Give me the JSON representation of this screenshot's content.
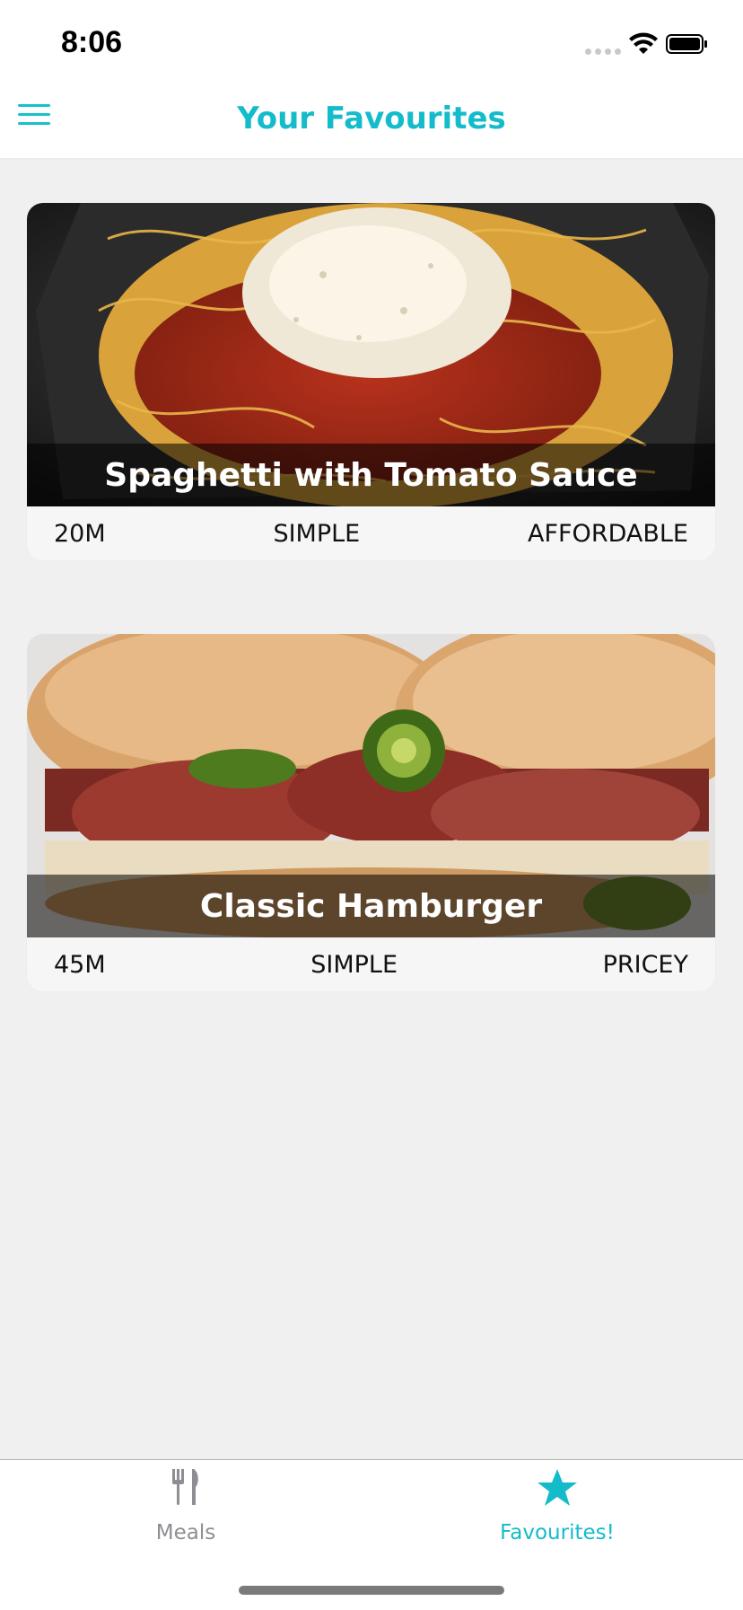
{
  "status_bar": {
    "time": "8:06"
  },
  "header": {
    "title": "Your Favourites",
    "menu_icon": "hamburger-menu-icon"
  },
  "favourites": [
    {
      "title": "Spaghetti with Tomato Sauce",
      "duration": "20M",
      "complexity": "SIMPLE",
      "affordability": "AFFORDABLE"
    },
    {
      "title": "Classic Hamburger",
      "duration": "45M",
      "complexity": "SIMPLE",
      "affordability": "PRICEY"
    }
  ],
  "tabbar": {
    "meals": {
      "label": "Meals",
      "icon": "fork-knife-icon"
    },
    "favourites": {
      "label": "Favourites!",
      "icon": "star-icon",
      "active": true
    }
  },
  "colors": {
    "accent": "#14bccb",
    "inactive": "#8e8e93",
    "background": "#f0f0f0"
  }
}
